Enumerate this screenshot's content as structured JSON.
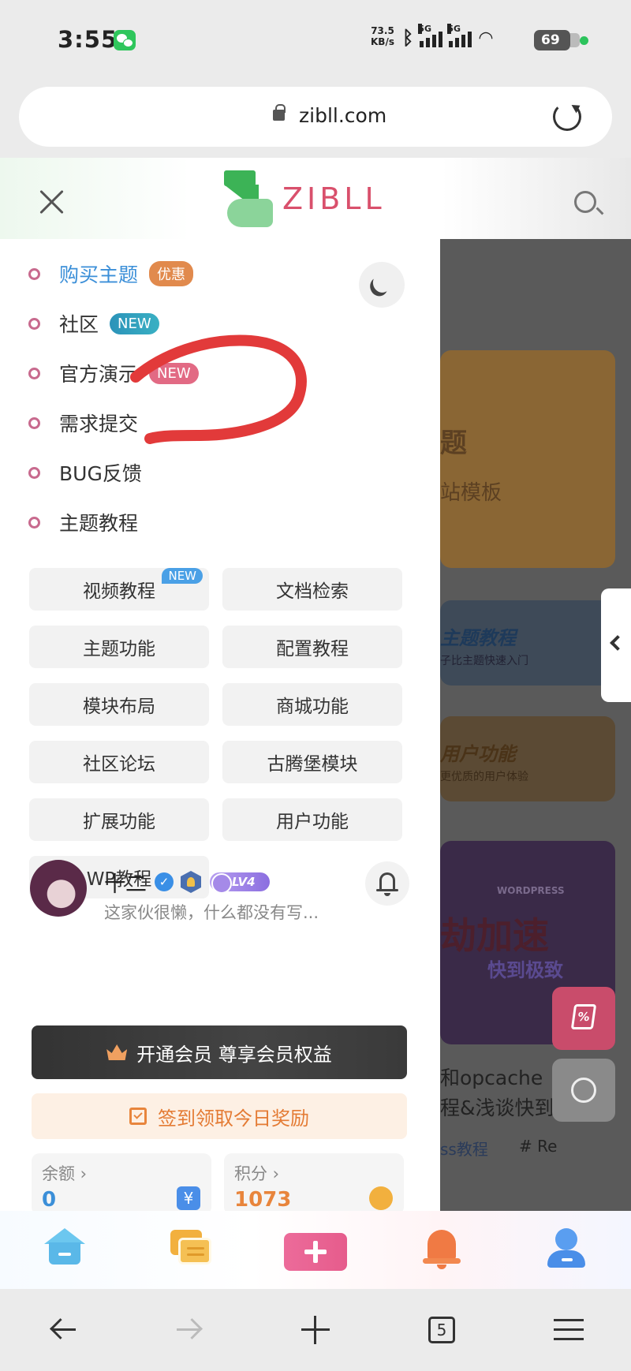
{
  "status_bar": {
    "time": "3:55",
    "net_speed_value": "73.5",
    "net_speed_unit": "KB/s",
    "sim1": "5G",
    "sim2": "5G",
    "battery": "69"
  },
  "url_bar": {
    "url": "zibll.com"
  },
  "header": {
    "logo_text": "ZIBLL"
  },
  "menu": {
    "items": [
      {
        "label": "购买主题",
        "badge": "优惠"
      },
      {
        "label": "社区",
        "badge": "NEW"
      },
      {
        "label": "官方演示",
        "badge": "NEW"
      },
      {
        "label": "需求提交",
        "badge": ""
      },
      {
        "label": "BUG反馈",
        "badge": ""
      },
      {
        "label": "主题教程",
        "badge": ""
      }
    ]
  },
  "tutorial_grid": {
    "buttons": [
      {
        "label": "视频教程",
        "tag": "NEW"
      },
      {
        "label": "文档检索"
      },
      {
        "label": "主题功能"
      },
      {
        "label": "配置教程"
      },
      {
        "label": "模块布局"
      },
      {
        "label": "商城功能"
      },
      {
        "label": "社区论坛"
      },
      {
        "label": "古腾堡模块"
      },
      {
        "label": "扩展功能"
      },
      {
        "label": "用户功能"
      },
      {
        "label": "WP教程"
      }
    ]
  },
  "user": {
    "name": "十二",
    "level": "LV4",
    "bio": "这家伙很懒，什么都没有写...",
    "vip_button": "开通会员 尊享会员权益",
    "checkin_button": "签到领取今日奖励",
    "balance": {
      "label": "余额 ›",
      "value": "0"
    },
    "points": {
      "label": "积分 ›",
      "value": "1073"
    }
  },
  "background": {
    "card1_title": "题",
    "card1_sub": "站模板",
    "card2_title": "主题教程",
    "card2_sub": "子比主题快速入门",
    "card3_title": "用户功能",
    "card3_sub": "更优质的用户体验",
    "card4_wp": "WORDPRESS",
    "card4_title": "劫加速",
    "card4_sub": "快到极致",
    "article_title_1": "和opcache",
    "article_title_2": "程&浅谈快到",
    "tag1": "ss教程",
    "tag2": "# Re"
  },
  "colors": {
    "accent_blue": "#3b8fd8",
    "brand_pink": "#d9506c",
    "brand_green": "#3cb356",
    "menu_dot": "#c86a8e"
  }
}
